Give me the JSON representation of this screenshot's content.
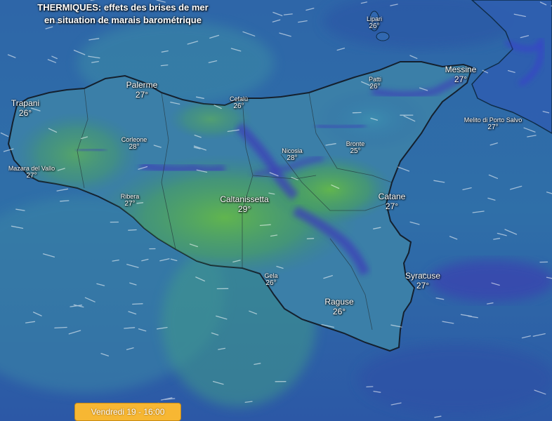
{
  "title": {
    "line1": "THERMIQUES: effets des brises de mer",
    "line2": "en situation de marais barométrique"
  },
  "cities": [
    {
      "name": "Lipari",
      "temp": "26°"
    },
    {
      "name": "Messine",
      "temp": "27°"
    },
    {
      "name": "Palerme",
      "temp": "27°"
    },
    {
      "name": "Patti",
      "temp": "26°"
    },
    {
      "name": "Trapani",
      "temp": "26°"
    },
    {
      "name": "Cefalù",
      "temp": "26°"
    },
    {
      "name": "Melito di Porto Salvo",
      "temp": "27°"
    },
    {
      "name": "Corleone",
      "temp": "28°"
    },
    {
      "name": "Nicosia",
      "temp": "28°"
    },
    {
      "name": "Bronte",
      "temp": "25°"
    },
    {
      "name": "Mazara del Vallo",
      "temp": "27°"
    },
    {
      "name": "Catane",
      "temp": "27°"
    },
    {
      "name": "Ribera",
      "temp": "27°"
    },
    {
      "name": "Caltanissetta",
      "temp": "29°"
    },
    {
      "name": "Gela",
      "temp": "26°"
    },
    {
      "name": "Syracuse",
      "temp": "27°"
    },
    {
      "name": "Raguse",
      "temp": "26°"
    }
  ],
  "time_label": "Vendredi 19 - 16:00",
  "colors": {
    "sea": "#2b5fa3",
    "land_warm": "#5fb84a",
    "land_cool": "#3a7fa8",
    "ridge": "#3b3fb0",
    "time_bar": "#f7b733"
  }
}
